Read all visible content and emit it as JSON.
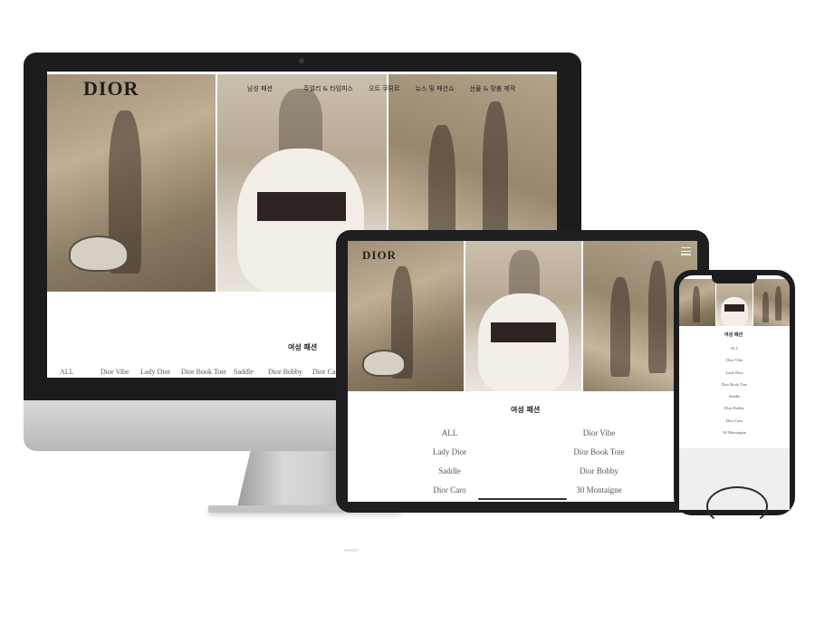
{
  "brand": {
    "logo": "DIOR"
  },
  "desktop": {
    "nav": [
      "남성 패션",
      "",
      "주얼리 & 타임피스",
      "오트 쿠튀르",
      "뉴스 및 패션쇼",
      "선물 & 맞춤 제작"
    ],
    "section_title": "여성 패션",
    "categories": [
      "ALL",
      "Dior Vibe",
      "Lady Dior",
      "Dior Book Tote",
      "Saddle",
      "Dior Bobby",
      "Dior Caro"
    ]
  },
  "tablet": {
    "section_title": "여성 패션",
    "categories": [
      "ALL",
      "Dior Vibe",
      "Lady Dior",
      "Dior Book Tote",
      "Saddle",
      "Dior Bobby",
      "Dior Caro",
      "30 Montaigne"
    ]
  },
  "mobile": {
    "section_title": "여성 패션",
    "categories": [
      "ALL",
      "Dior Vibe",
      "Lady Dior",
      "Dior Book Tote",
      "Saddle",
      "Dior Bobby",
      "Dior Caro",
      "30 Montaigne"
    ]
  },
  "icons": {
    "menu": "hamburger-menu-icon"
  }
}
